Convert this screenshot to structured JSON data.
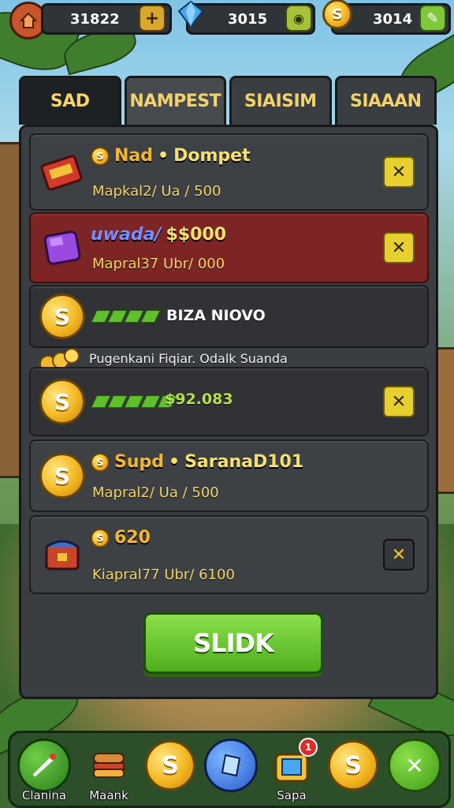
{
  "colors": {
    "accent": "#f2d36b",
    "gold": "#f2b722",
    "green": "#5fc02b",
    "red_row": "#7d2424"
  },
  "topbar": {
    "home_icon": "house-icon",
    "res1": {
      "value": "31822",
      "button": "+",
      "button_icon": "plus-icon"
    },
    "res2": {
      "value": "3015",
      "icon": "gem-icon",
      "button_icon": "coin-slot-icon"
    },
    "res3": {
      "value": "3014",
      "icon": "coin-icon",
      "button_icon": "pencil-icon"
    }
  },
  "tabs": [
    {
      "label": "SAD"
    },
    {
      "label": "NAMPEST"
    },
    {
      "label": "SIAISIM"
    },
    {
      "label": "SIAAAN"
    }
  ],
  "rows": [
    {
      "title_a": "Nad",
      "sep": "•",
      "title_b": "Dompet",
      "sub": "Mapkal2/ Ua / 500",
      "icon": "red-chest-icon"
    },
    {
      "title_a": "uwada/",
      "title_b": "$$000",
      "sub": "Mapral37 Ubr/ 000",
      "icon": "purple-gem-icon"
    },
    {
      "title": "BIZA NIOVO",
      "icon": "coin-icon"
    },
    {
      "title": "$92.083",
      "icon": "coin-icon"
    },
    {
      "title_a": "Supd",
      "sep": "•",
      "title_b": "SaranaD101",
      "sub": "Mapral2/ Ua / 500",
      "icon": "coin-icon"
    },
    {
      "title_a": "620",
      "sub": "Kiapral77 Ubr/ 6100",
      "icon": "blue-chest-icon"
    }
  ],
  "mid_label": "Pugenkani Fiqiar. Odalk Suanda",
  "coin_symbol": "S",
  "close_symbol": "✕",
  "go_button": "SLIDK",
  "bottom_nav": [
    {
      "label": "Clanina",
      "icon": "sword-icon"
    },
    {
      "label": "Maank",
      "icon": "burger-chest-icon"
    },
    {
      "label": "",
      "icon": "coin-icon"
    },
    {
      "label": "",
      "icon": "blue-gem-icon"
    },
    {
      "label": "Sapa",
      "icon": "gift-box-icon",
      "badge": "1"
    },
    {
      "label": "",
      "icon": "coin-icon"
    },
    {
      "label": "",
      "icon": "close-icon"
    }
  ]
}
